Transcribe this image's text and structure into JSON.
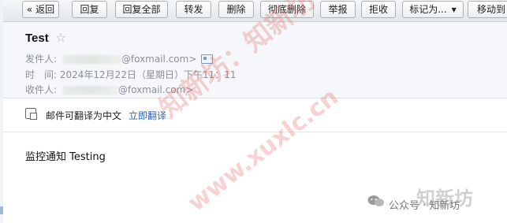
{
  "toolbar": {
    "back": "« 返回",
    "reply": "回复",
    "reply_all": "回复全部",
    "forward": "转发",
    "delete": "删除",
    "perm_delete": "彻底删除",
    "report": "举报",
    "reject": "拒收",
    "mark_as": "标记为...",
    "move_to": "移动到"
  },
  "mail": {
    "subject": "Test",
    "star_glyph": "☆",
    "from_label": "发件人:",
    "from_domain": "@foxmail.com>",
    "time_label": "时　间:",
    "time_value": "2024年12月22日（星期日）下午11：11",
    "to_label": "收件人:",
    "to_domain": "@foxmail.com>"
  },
  "translate": {
    "notice": "邮件可翻译为中文",
    "link": "立即翻译"
  },
  "body": {
    "text": "监控通知 Testing"
  },
  "watermark": {
    "line1": "知新坊：知新坊",
    "line2": "www.xuxlc.cn"
  },
  "branding": {
    "big": "知新坊",
    "small": "公众号 · 知新坊"
  },
  "icons": {
    "star": "star-icon",
    "vcard": "contact-card-icon",
    "translate": "translate-icon",
    "wechat": "wechat-icon"
  }
}
